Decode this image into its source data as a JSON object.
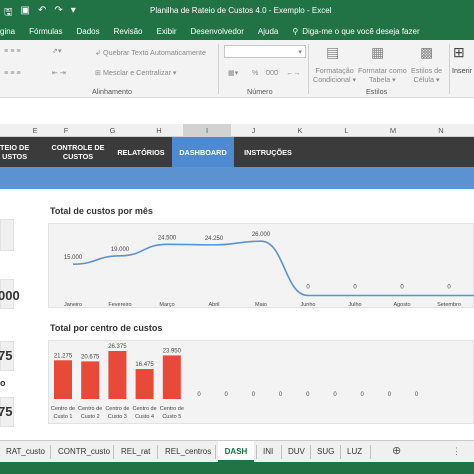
{
  "window": {
    "title": "Planilha de Rateio de Custos 4.0 - Exemplo  -  Excel"
  },
  "menu": [
    "gina",
    "Fórmulas",
    "Dados",
    "Revisão",
    "Exibir",
    "Desenvolvedor",
    "Ajuda"
  ],
  "tell_me": "Diga-me o que você deseja fazer",
  "ribbon": {
    "wrap_text": "Quebrar Texto Automaticamente",
    "merge_center": "Mesclar e Centralizar",
    "alignment_label": "Alinhamento",
    "number_label": "Número",
    "conditional_format": [
      "Formatação",
      "Condicional"
    ],
    "format_as_table": [
      "Formatar como",
      "Tabela"
    ],
    "cell_styles": [
      "Estilos de",
      "Célula"
    ],
    "styles_label": "Estilos",
    "insert": "Inserir",
    "percent": "%",
    "thousands": "000"
  },
  "columns": [
    "E",
    "F",
    "G",
    "H",
    "I",
    "J",
    "K",
    "L",
    "M",
    "N"
  ],
  "selected_column": "I",
  "nav": {
    "rateio": [
      "TEIO DE",
      "USTOS"
    ],
    "controle": [
      "CONTROLE DE",
      "CUSTOS"
    ],
    "relatorios": "RELATÓRIOS",
    "dashboard": "DASHBOARD",
    "instrucoes": "INSTRUÇÕES"
  },
  "kpis": {
    "kpi2_value": "000",
    "kpi3_value": "75",
    "kpi3_label": "o",
    "kpi4_value": "75"
  },
  "chart_data": [
    {
      "type": "line",
      "title": "Total de custos por mês",
      "categories": [
        "Janeiro",
        "Fevereiro",
        "Março",
        "Abril",
        "Maio",
        "Junho",
        "Julho",
        "Agosto",
        "Setembro"
      ],
      "values": [
        15000,
        19000,
        24500,
        24250,
        26000,
        0,
        0,
        0,
        0
      ],
      "labels": [
        "15.000",
        "19.000",
        "24.500",
        "24.250",
        "26.000",
        "0",
        "0",
        "0",
        "0"
      ],
      "color": "#5b92d2",
      "ylim": [
        0,
        30000
      ],
      "grid": false
    },
    {
      "type": "bar",
      "title": "Total por centro de custos",
      "categories": [
        "Centro de Custo 1",
        "Centro de Custo 2",
        "Centro de Custo 3",
        "Centro de Custo 4",
        "Centro de Custo 5",
        "",
        "",
        "",
        "",
        "",
        "",
        "",
        "",
        ""
      ],
      "values": [
        21275,
        20675,
        26375,
        16475,
        23950,
        0,
        0,
        0,
        0,
        0,
        0,
        0,
        0,
        0
      ],
      "labels": [
        "21.275",
        "20.675",
        "26.375",
        "16.475",
        "23.950",
        "0",
        "0",
        "0",
        "0",
        "0",
        "0",
        "0",
        "0",
        "0"
      ],
      "category_line1": "Centro de",
      "category_line2": [
        "Custo 1",
        "Custo 2",
        "Custo 3",
        "Custo 4",
        "Custo 5"
      ],
      "color": "#e84a3a",
      "ylim": [
        0,
        30000
      ],
      "grid": false
    }
  ],
  "sheet_tabs": [
    "RAT_custo",
    "CONTR_custo",
    "REL_rat",
    "REL_centros",
    "DASH",
    "INI",
    "DUV",
    "SUG",
    "LUZ"
  ],
  "active_tab": "DASH",
  "colors": {
    "excel_green": "#217346",
    "nav_dark": "#3b3b3b",
    "nav_active": "#4f8ad1",
    "band_blue": "#5b92d2"
  }
}
